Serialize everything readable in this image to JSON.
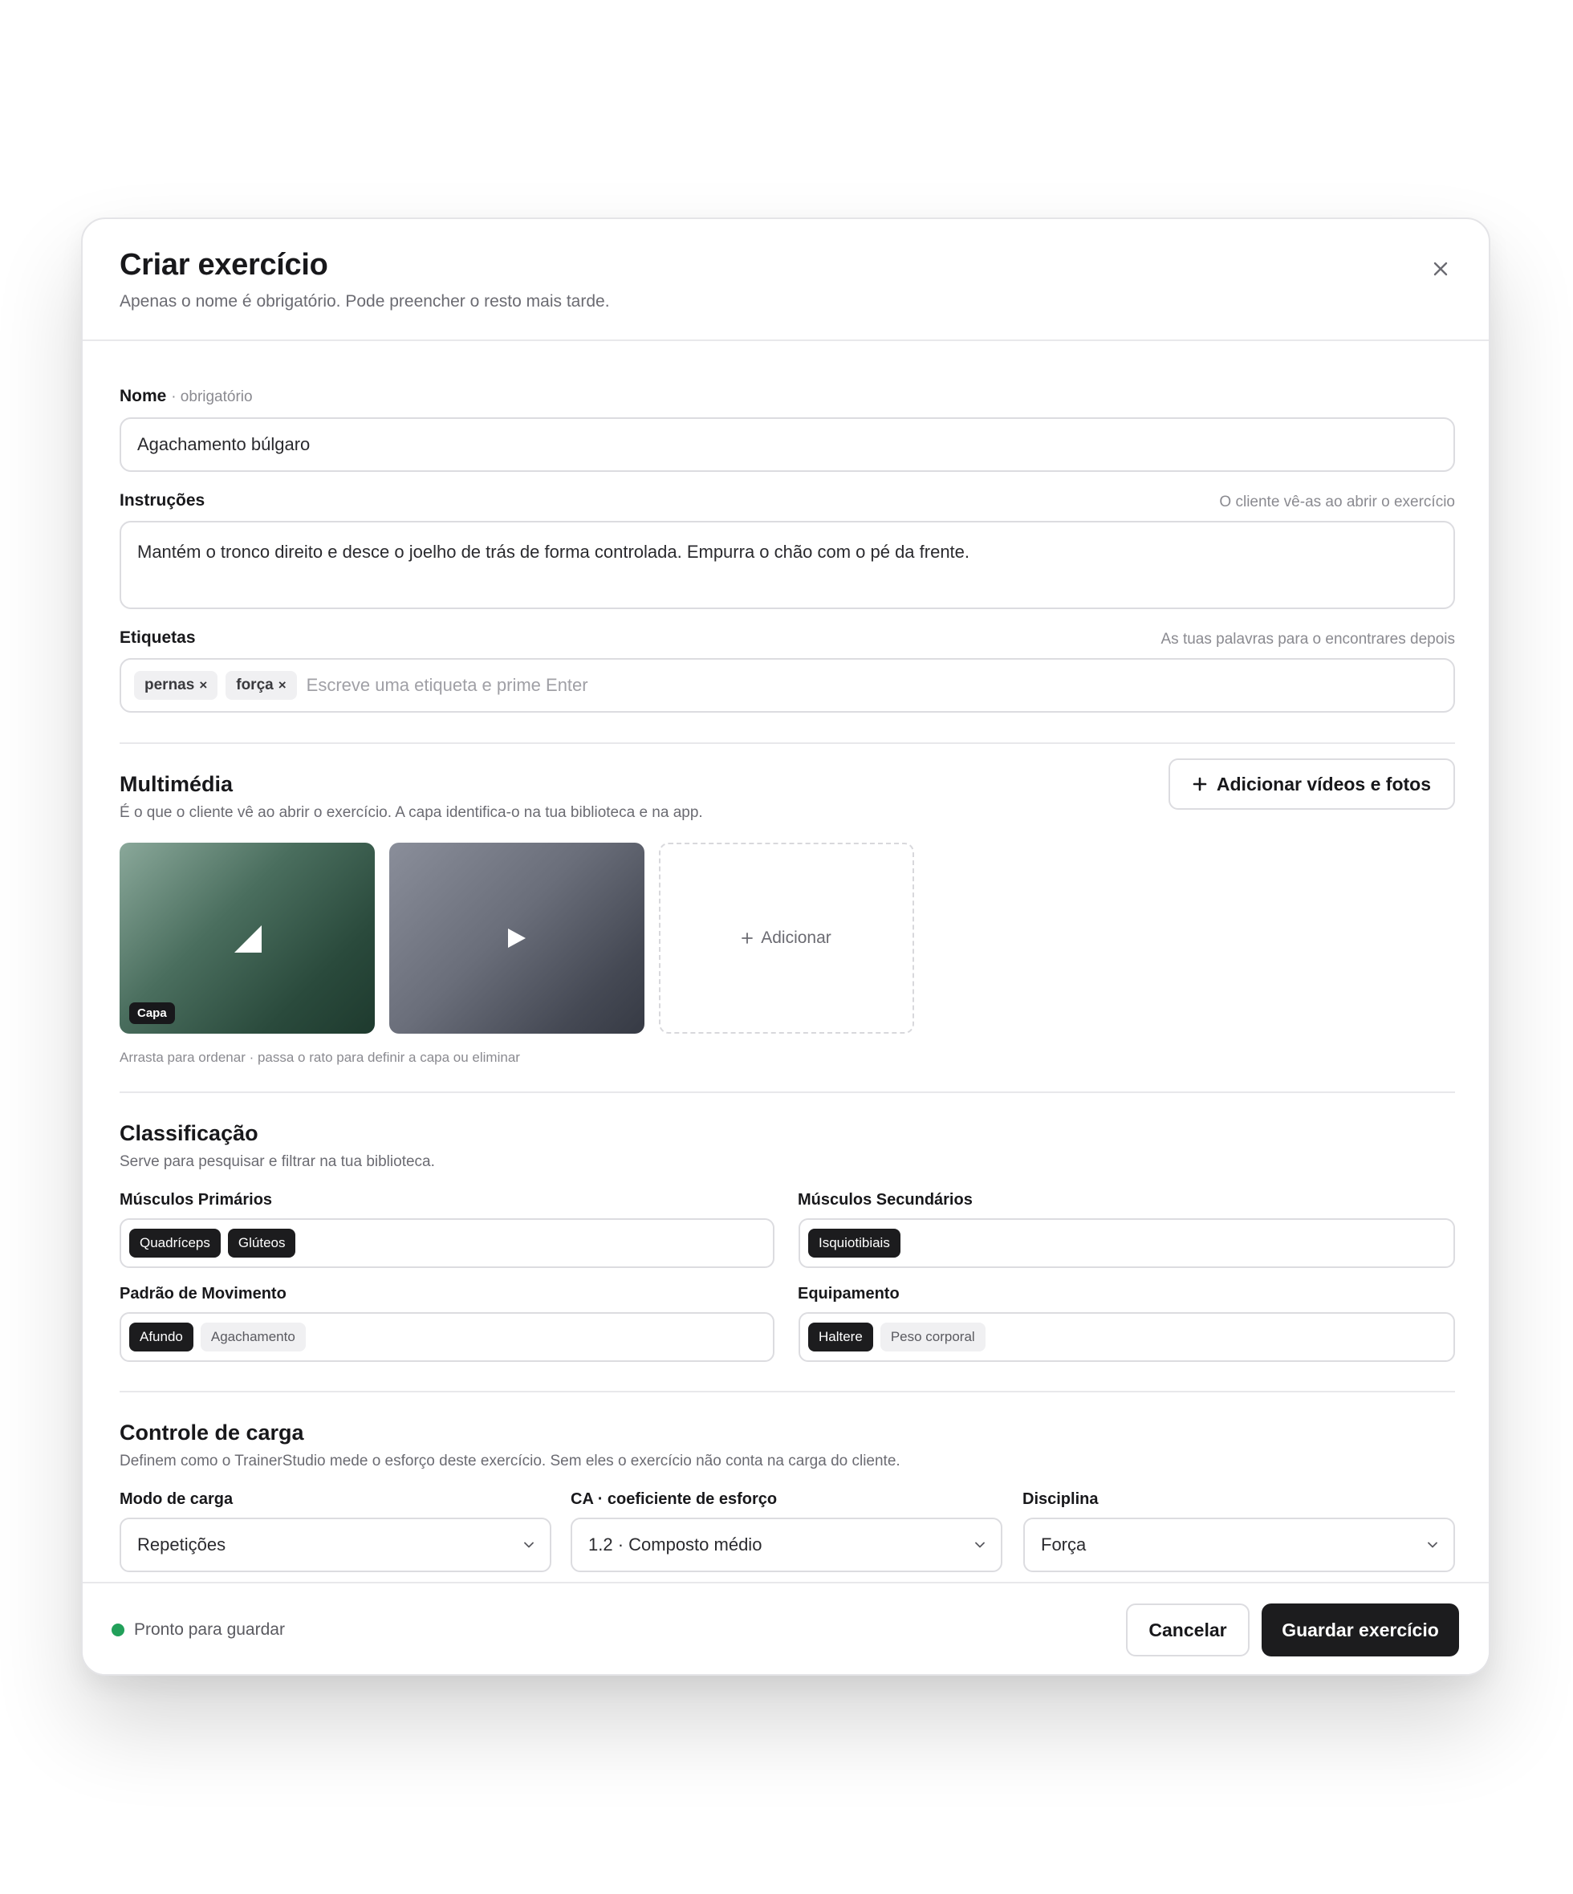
{
  "dialog": {
    "title": "Criar exercício",
    "subtitle": "Apenas o nome é obrigatório. Pode preencher o resto mais tarde.",
    "close_icon": "close-icon"
  },
  "name_field": {
    "label": "Nome",
    "required_note": "· obrigatório",
    "value": "Agachamento búlgaro"
  },
  "instructions_field": {
    "label": "Instruções",
    "hint": "O cliente vê-as ao abrir o exercício",
    "value": "Mantém o tronco direito e desce o joelho de trás de forma controlada. Empurra o chão com o pé da frente."
  },
  "tags_field": {
    "label": "Etiquetas",
    "hint": "As tuas palavras para o encontrares depois",
    "tags": [
      "pernas",
      "força"
    ],
    "remove_glyph": "×",
    "placeholder": "Escreve uma etiqueta e prime Enter"
  },
  "media": {
    "title": "Multimédia",
    "subtitle": "É o que o cliente vê ao abrir o exercício. A capa identifica-o na tua biblioteca e na app.",
    "add_button": "Adicionar vídeos e fotos",
    "add_button_icon": "plus-icon",
    "items": [
      {
        "kind": "image",
        "icon": "image-icon",
        "badge": "Capa"
      },
      {
        "kind": "video",
        "icon": "play-icon"
      }
    ],
    "add_tile": "Adicionar",
    "hint": "Arrasta para ordenar · passa o rato para definir a capa ou eliminar"
  },
  "classification": {
    "title": "Classificação",
    "subtitle": "Serve para pesquisar e filtrar na tua biblioteca.",
    "primary_muscles": {
      "label": "Músculos Primários",
      "chips": [
        {
          "text": "Quadríceps",
          "selected": true
        },
        {
          "text": "Glúteos",
          "selected": true
        }
      ]
    },
    "secondary_muscles": {
      "label": "Músculos Secundários",
      "chips": [
        {
          "text": "Isquiotibiais",
          "selected": true
        }
      ]
    },
    "movement_pattern": {
      "label": "Padrão de Movimento",
      "chips": [
        {
          "text": "Afundo",
          "selected": true
        },
        {
          "text": "Agachamento",
          "selected": false
        }
      ]
    },
    "equipment": {
      "label": "Equipamento",
      "chips": [
        {
          "text": "Haltere",
          "selected": true
        },
        {
          "text": "Peso corporal",
          "selected": false
        }
      ]
    }
  },
  "load": {
    "title": "Controle de carga",
    "subtitle": "Definem como o TrainerStudio mede o esforço deste exercício. Sem eles o exercício não conta na carga do cliente.",
    "mode": {
      "label": "Modo de carga",
      "value": "Repetições"
    },
    "coefficient": {
      "label": "CA · coeficiente de esforço",
      "value": "1.2 · Composto médio"
    },
    "discipline": {
      "label": "Disciplina",
      "value": "Força"
    },
    "chevron_icon": "chevron-down-icon"
  },
  "footer": {
    "status": "Pronto para guardar",
    "status_color": "#22a05a",
    "cancel": "Cancelar",
    "save": "Guardar exercício"
  }
}
